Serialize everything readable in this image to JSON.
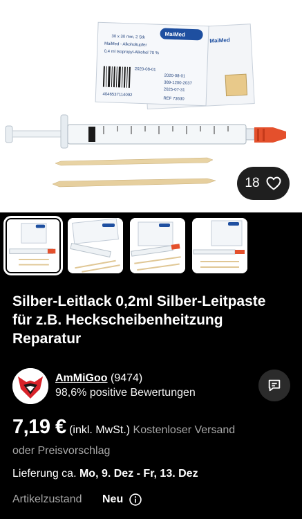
{
  "product": {
    "likes_count": "18",
    "title": "Silber-Leitlack 0,2ml Silber-Leitpaste für z.B. Heckscheibenheitzung Reparatur"
  },
  "hero_image": {
    "pad_brand": "MaiMed",
    "pad_text_1": "30 x 30 mm, 2 Stk",
    "pad_text_2": "MaiMed - Alkoholtupfer",
    "pad_text_3": "0,4 ml Isopropyl-Alkohol 70 %",
    "pad_barcode": "4046537114092",
    "pad_date_1": "2020-08-01",
    "pad_lot": "389-1200-2037",
    "pad_date_2": "2025-07-31",
    "pad_ref": "REF 73630"
  },
  "thumbnails": [
    {
      "label": "image-1",
      "active": true
    },
    {
      "label": "image-2",
      "active": false
    },
    {
      "label": "image-3",
      "active": false
    },
    {
      "label": "image-4",
      "active": false
    }
  ],
  "seller": {
    "name": "AmMiGoo",
    "feedback_count": "(9474)",
    "positive": "98,6% positive Bewertungen"
  },
  "pricing": {
    "price": "7,19 €",
    "tax_note": "(inkl. MwSt.)",
    "shipping": "Kostenloser Versand",
    "offer": "oder Preisvorschlag"
  },
  "delivery": {
    "prefix": "Lieferung ca.",
    "range": "Mo, 9. Dez - Fr, 13. Dez"
  },
  "condition": {
    "label": "Artikelzustand",
    "value": "Neu"
  },
  "icons": {
    "heart": "heart-icon",
    "chat": "chat-icon",
    "info": "info-icon"
  },
  "colors": {
    "background": "#000000",
    "muted_text": "#a8a8a8",
    "syringe_cap": "#e4502c"
  }
}
